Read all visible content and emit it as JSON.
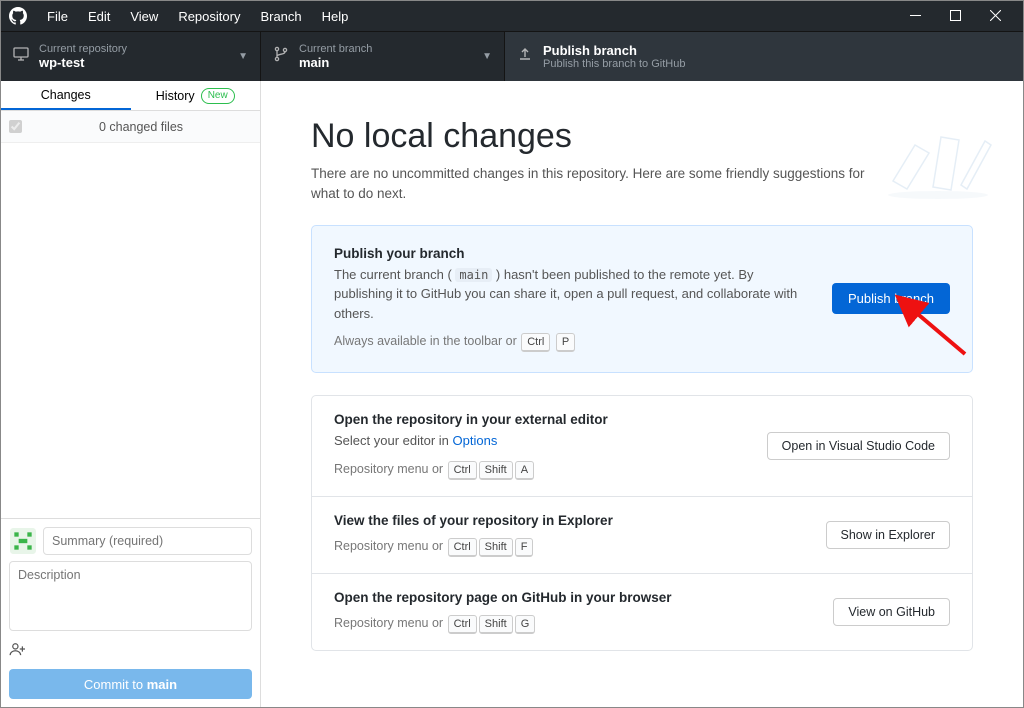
{
  "menubar": {
    "items": [
      "File",
      "Edit",
      "View",
      "Repository",
      "Branch",
      "Help"
    ]
  },
  "toolbar": {
    "repo": {
      "label": "Current repository",
      "value": "wp-test"
    },
    "branch": {
      "label": "Current branch",
      "value": "main"
    },
    "publish": {
      "label": "Publish branch",
      "sub": "Publish this branch to GitHub"
    }
  },
  "sidebar": {
    "tabs": {
      "changes": "Changes",
      "history": "History",
      "history_badge": "New"
    },
    "changes_count": "0 changed files",
    "summary_placeholder": "Summary (required)",
    "description_placeholder": "Description",
    "commit_prefix": "Commit to ",
    "commit_branch": "main"
  },
  "main": {
    "heading": "No local changes",
    "subtitle": "There are no uncommitted changes in this repository. Here are some friendly suggestions for what to do next."
  },
  "publish_card": {
    "title": "Publish your branch",
    "desc_a": "The current branch ( ",
    "branch": "main",
    "desc_b": " ) hasn't been published to the remote yet. By publishing it to GitHub you can share it, open a pull request, and collaborate with others.",
    "shortcut_prefix": "Always available in the toolbar or",
    "keys": [
      "Ctrl",
      "P"
    ],
    "button": "Publish branch"
  },
  "cards": [
    {
      "title": "Open the repository in your external editor",
      "desc": "Select your editor in ",
      "link": "Options",
      "shortcut_prefix": "Repository menu or",
      "keys": [
        "Ctrl",
        "Shift",
        "A"
      ],
      "button": "Open in Visual Studio Code"
    },
    {
      "title": "View the files of your repository in Explorer",
      "desc": "",
      "link": "",
      "shortcut_prefix": "Repository menu or",
      "keys": [
        "Ctrl",
        "Shift",
        "F"
      ],
      "button": "Show in Explorer"
    },
    {
      "title": "Open the repository page on GitHub in your browser",
      "desc": "",
      "link": "",
      "shortcut_prefix": "Repository menu or",
      "keys": [
        "Ctrl",
        "Shift",
        "G"
      ],
      "button": "View on GitHub"
    }
  ]
}
